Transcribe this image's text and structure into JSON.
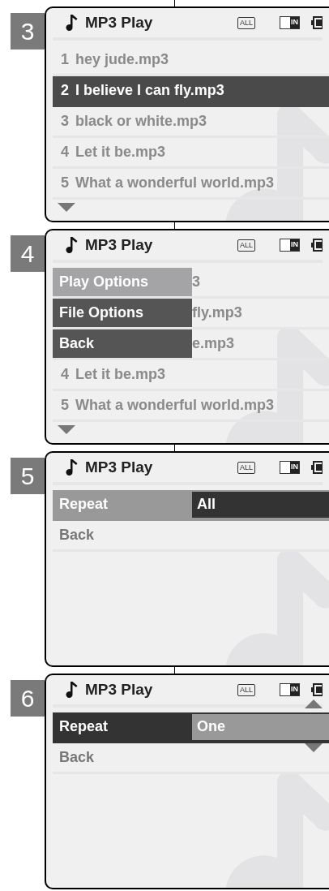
{
  "screens": [
    {
      "step": "3",
      "title": "MP3 Play",
      "repeat_mode": "ALL",
      "memory": "IN",
      "kind": "list",
      "more_below": true,
      "rows": [
        {
          "number": "1",
          "name": "hey jude.mp3",
          "selected": false
        },
        {
          "number": "2",
          "name": "I believe I can fly.mp3",
          "selected": true
        },
        {
          "number": "3",
          "name": "black or white.mp3",
          "selected": false
        },
        {
          "number": "4",
          "name": "Let it be.mp3",
          "selected": false
        },
        {
          "number": "5",
          "name": "What a wonderful world.mp3",
          "selected": false
        }
      ]
    },
    {
      "step": "4",
      "title": "MP3 Play",
      "repeat_mode": "ALL",
      "memory": "IN",
      "kind": "menu",
      "more_below": true,
      "menu": [
        {
          "label": "Play Options",
          "behind": "3",
          "selected": true
        },
        {
          "label": "File Options",
          "behind": "fly.mp3",
          "selected": false
        },
        {
          "label": "Back",
          "behind": "e.mp3",
          "selected": false
        }
      ],
      "rows": [
        {
          "number": "4",
          "name": "Let it be.mp3",
          "selected": false
        },
        {
          "number": "5",
          "name": "What a wonderful world.mp3",
          "selected": false
        }
      ]
    },
    {
      "step": "5",
      "title": "MP3 Play",
      "repeat_mode": "ALL",
      "memory": "IN",
      "kind": "settings",
      "editing": false,
      "settings": [
        {
          "label": "Repeat",
          "value": "All",
          "selected": true
        },
        {
          "label": "Back",
          "selected": false
        }
      ]
    },
    {
      "step": "6",
      "title": "MP3 Play",
      "repeat_mode": "ALL",
      "memory": "IN",
      "kind": "settings",
      "editing": true,
      "settings": [
        {
          "label": "Repeat",
          "value": "One",
          "selected": true
        },
        {
          "label": "Back",
          "selected": false
        }
      ]
    }
  ]
}
